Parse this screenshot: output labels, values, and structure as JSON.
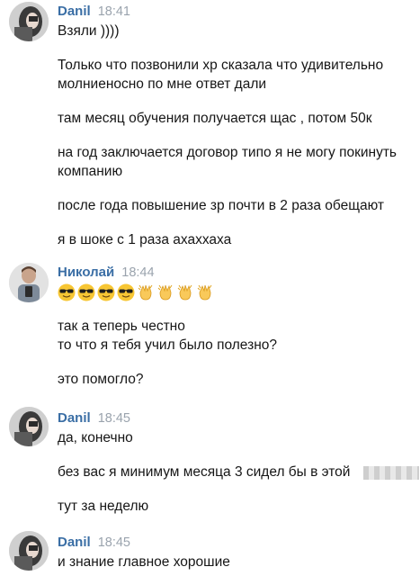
{
  "messages": [
    {
      "sender": "Danil",
      "time": "18:41",
      "avatar": "woman-portrait-avatar",
      "lines": [
        "Взяли ))))",
        "Только что позвонили хр сказала что удивительно",
        "молниеносно по мне ответ дали",
        "там месяц обучения получается щас , потом 50к",
        "на год заключается договор типо я не могу покинуть",
        "компанию",
        "после года повышение зр почти в 2 раза обещают",
        "я в шоке с 1 раза ахаххаха"
      ]
    },
    {
      "sender": "Николай",
      "time": "18:44",
      "avatar": "man-portrait-avatar",
      "emoji": [
        "sunglasses-emoji",
        "sunglasses-emoji",
        "sunglasses-emoji",
        "sunglasses-emoji",
        "clapping-hands-emoji",
        "clapping-hands-emoji",
        "clapping-hands-emoji",
        "clapping-hands-emoji"
      ],
      "lines": [
        "так а теперь честно",
        "то что я тебя учил было полезно?",
        "это помогло?"
      ]
    },
    {
      "sender": "Danil",
      "time": "18:45",
      "avatar": "woman-portrait-avatar",
      "lines": [
        "да, конечно",
        "без вас я минимум месяца 3 сидел бы в этой",
        "тут за неделю"
      ]
    },
    {
      "sender": "Danil",
      "time": "18:45",
      "avatar": "woman-portrait-avatar",
      "lines": [
        "и знание главное хорошие"
      ]
    }
  ],
  "colors": {
    "sender_name": "#3a6ea5",
    "timestamp": "#9aa3ad",
    "text": "#161616",
    "background": "#ffffff"
  }
}
